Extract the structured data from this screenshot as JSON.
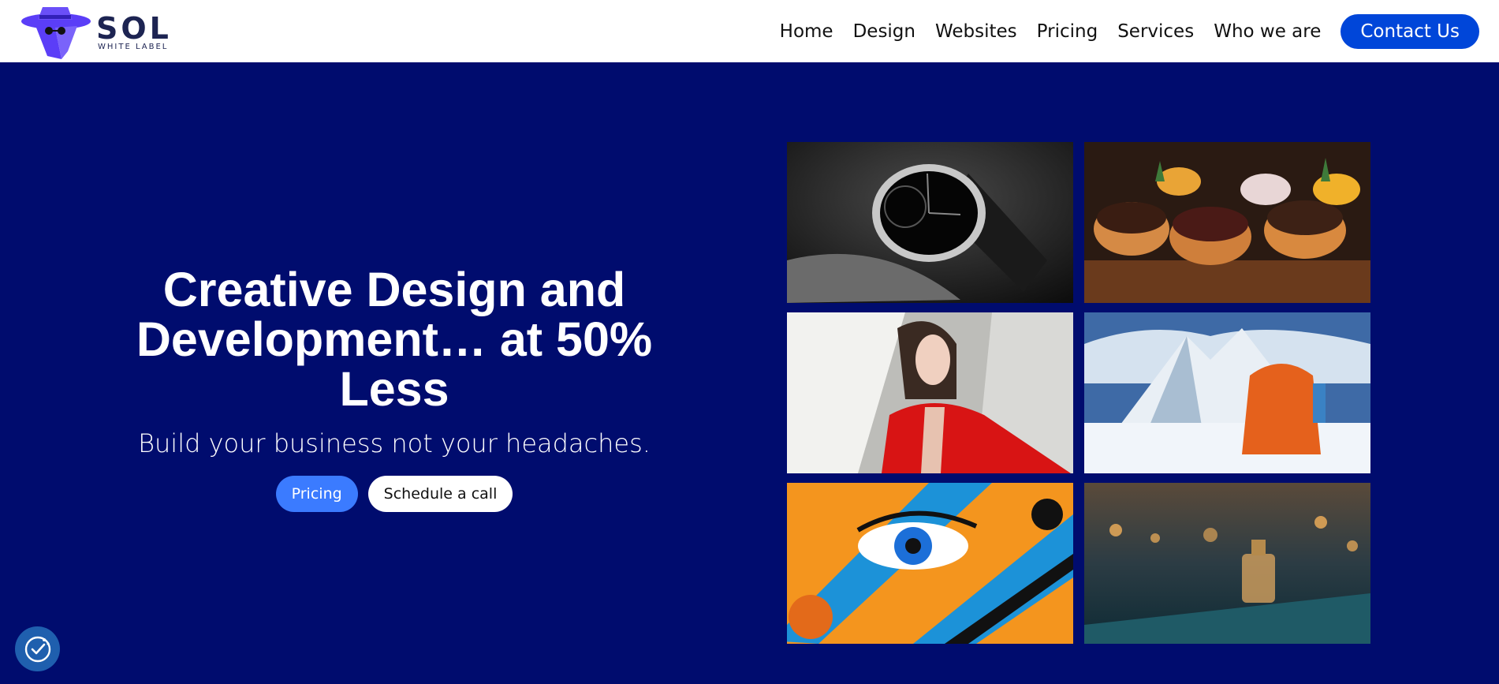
{
  "brand": {
    "name": "SOL",
    "tagline": "WHITE LABEL",
    "accent": "#5b3ef7"
  },
  "nav": {
    "items": [
      "Home",
      "Design",
      "Websites",
      "Pricing",
      "Services",
      "Who we are"
    ],
    "cta": "Contact Us"
  },
  "hero": {
    "title_line1": "Creative Design and",
    "title_line2": "Development… at 50%",
    "title_line3": "Less",
    "subtitle": "Build your business not your headaches.",
    "primary_button": "Pricing",
    "secondary_button": "Schedule a call"
  },
  "gallery": {
    "images": [
      "watch",
      "donuts",
      "woman-in-red-jacket",
      "backpack-in-snow",
      "pop-art-eye",
      "perfume-bottle"
    ]
  },
  "colors": {
    "header_bg": "#ffffff",
    "hero_bg": "#000c6e",
    "cta_bg": "#0046d9",
    "pricing_btn": "#3b7bff"
  },
  "cookie_settings": {
    "icon": "cookie-consent-icon"
  }
}
